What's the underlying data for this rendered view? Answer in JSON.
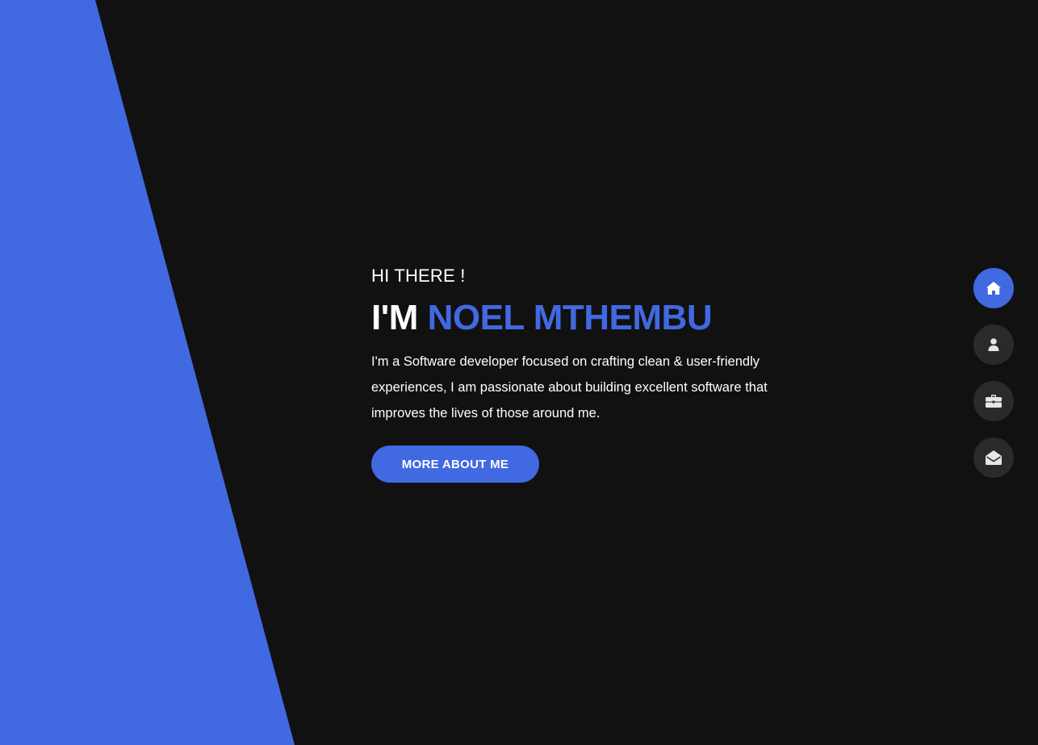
{
  "hero": {
    "greeting": "HI THERE !",
    "prefix": "I'M",
    "name": "NOEL MTHEMBU",
    "intro": "I'm a Software developer focused on crafting clean & user-friendly experiences, I am passionate about building excellent software that improves the lives of those around me.",
    "cta_label": "MORE ABOUT ME"
  },
  "nav": [
    {
      "icon": "home-icon",
      "active": true
    },
    {
      "icon": "user-icon",
      "active": false
    },
    {
      "icon": "briefcase-icon",
      "active": false
    },
    {
      "icon": "envelope-open-icon",
      "active": false
    }
  ],
  "colors": {
    "accent": "#4169e1",
    "background": "#111111",
    "nav_inactive": "#2b2a2a",
    "text": "#ffffff"
  }
}
